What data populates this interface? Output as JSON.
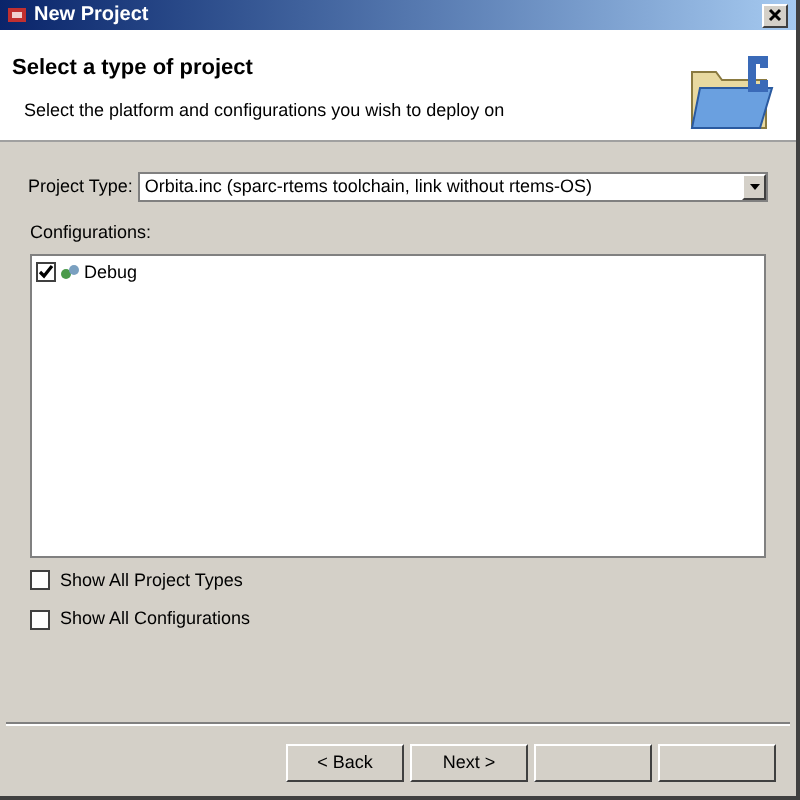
{
  "window": {
    "title": "New Project"
  },
  "header": {
    "title": "Select a type of project",
    "description": "Select the platform and configurations you wish to deploy on"
  },
  "project_type": {
    "label": "Project Type:",
    "value": "Orbita.inc (sparc-rtems toolchain, link without rtems-OS)"
  },
  "configurations": {
    "label": "Configurations:",
    "items": [
      {
        "label": "Debug",
        "checked": true
      }
    ]
  },
  "options": [
    {
      "label": "Show All Project Types",
      "checked": false
    },
    {
      "label": "Show All Configurations",
      "checked": false
    }
  ],
  "buttons": [
    {
      "kind": "labeled",
      "label": "< Back"
    },
    {
      "kind": "labeled",
      "label": "Next >"
    },
    {
      "kind": "blank"
    },
    {
      "kind": "blank"
    }
  ]
}
